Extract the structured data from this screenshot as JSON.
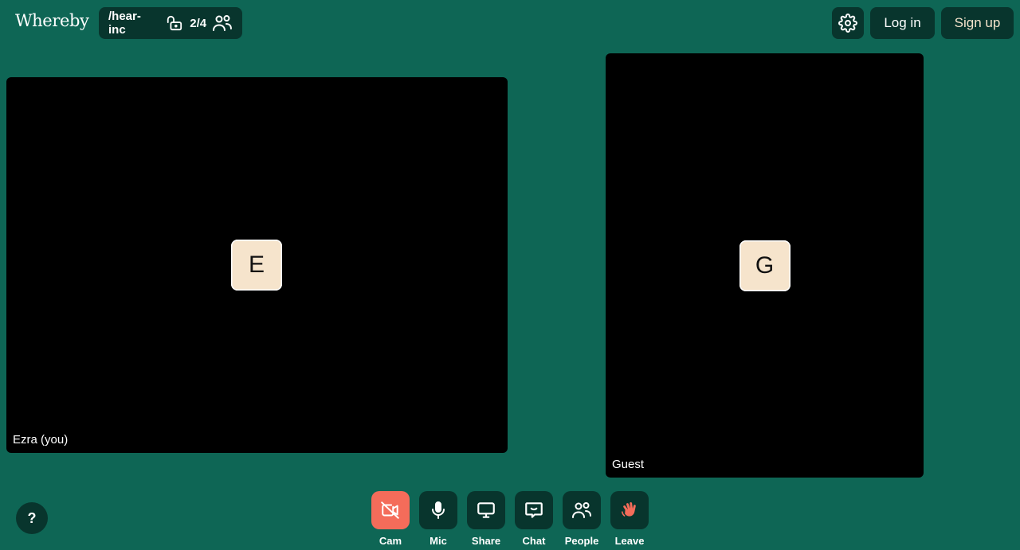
{
  "brand": {
    "logo_text": "Whereby"
  },
  "room": {
    "name": "/hear-inc",
    "participants": "2/4",
    "lock_icon": "unlocked-padlock-icon",
    "people_icon": "people-icon"
  },
  "header": {
    "settings_icon": "gear-icon",
    "login_label": "Log in",
    "signup_label": "Sign up"
  },
  "tiles": [
    {
      "initial": "E",
      "label": "Ezra (you)"
    },
    {
      "initial": "G",
      "label": "Guest"
    }
  ],
  "help": {
    "label": "?"
  },
  "controls": [
    {
      "label": "Cam",
      "icon": "camera-off-icon",
      "state": "off"
    },
    {
      "label": "Mic",
      "icon": "microphone-icon"
    },
    {
      "label": "Share",
      "icon": "screen-share-icon"
    },
    {
      "label": "Chat",
      "icon": "chat-icon"
    },
    {
      "label": "People",
      "icon": "people-icon"
    },
    {
      "label": "Leave",
      "icon": "waving-hand-icon"
    }
  ],
  "colors": {
    "background": "#0e6655",
    "panel": "#08352d",
    "accent": "#f46c5a",
    "avatar": "#f6e4cc"
  }
}
